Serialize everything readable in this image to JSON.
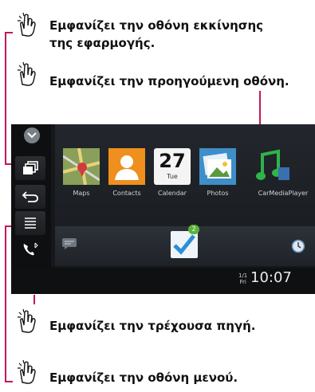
{
  "annotations": {
    "home": "Εμφανίζει την οθόνη εκκίνησης",
    "home_line2": "της εφαρμογής.",
    "previous": "Εμφανίζει την προηγούμενη οθόνη.",
    "source": "Εμφανίζει την τρέχουσα πηγή.",
    "menu": "Εμφανίζει την οθόνη μενού."
  },
  "apps": [
    {
      "label": "Maps",
      "icon": "maps-icon"
    },
    {
      "label": "Contacts",
      "icon": "contacts-icon"
    },
    {
      "label": "Calendar",
      "icon": "calendar-icon",
      "day": "27",
      "weekday": "Tue"
    },
    {
      "label": "Photos",
      "icon": "photos-icon"
    },
    {
      "label": "CarMediaPlayer",
      "icon": "music-icon"
    }
  ],
  "dock": {
    "badge": "2"
  },
  "status": {
    "time": "10:07",
    "date_top": "1/1",
    "date_bottom": "Fri"
  },
  "colors": {
    "annotation_line": "#c2185b"
  }
}
